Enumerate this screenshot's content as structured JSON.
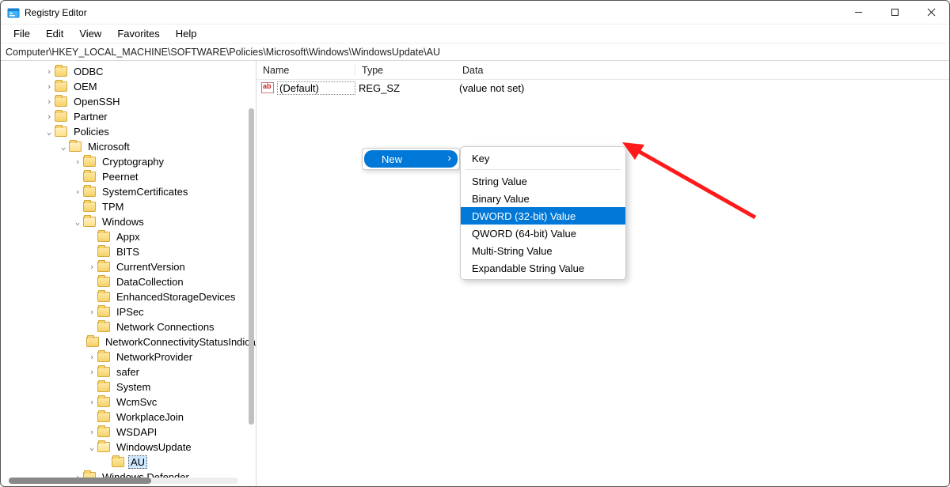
{
  "window": {
    "title": "Registry Editor"
  },
  "menu": {
    "items": [
      "File",
      "Edit",
      "View",
      "Favorites",
      "Help"
    ]
  },
  "address": {
    "path": "Computer\\HKEY_LOCAL_MACHINE\\SOFTWARE\\Policies\\Microsoft\\Windows\\WindowsUpdate\\AU"
  },
  "tree": [
    {
      "indent": 3,
      "expander": ">",
      "label": "ODBC"
    },
    {
      "indent": 3,
      "expander": ">",
      "label": "OEM"
    },
    {
      "indent": 3,
      "expander": ">",
      "label": "OpenSSH"
    },
    {
      "indent": 3,
      "expander": ">",
      "label": "Partner"
    },
    {
      "indent": 3,
      "expander": "v",
      "label": "Policies",
      "open": true
    },
    {
      "indent": 4,
      "expander": "v",
      "label": "Microsoft",
      "open": true
    },
    {
      "indent": 5,
      "expander": ">",
      "label": "Cryptography"
    },
    {
      "indent": 5,
      "expander": "",
      "label": "Peernet"
    },
    {
      "indent": 5,
      "expander": ">",
      "label": "SystemCertificates"
    },
    {
      "indent": 5,
      "expander": "",
      "label": "TPM"
    },
    {
      "indent": 5,
      "expander": "v",
      "label": "Windows",
      "open": true
    },
    {
      "indent": 6,
      "expander": "",
      "label": "Appx"
    },
    {
      "indent": 6,
      "expander": "",
      "label": "BITS"
    },
    {
      "indent": 6,
      "expander": ">",
      "label": "CurrentVersion"
    },
    {
      "indent": 6,
      "expander": "",
      "label": "DataCollection"
    },
    {
      "indent": 6,
      "expander": "",
      "label": "EnhancedStorageDevices"
    },
    {
      "indent": 6,
      "expander": ">",
      "label": "IPSec"
    },
    {
      "indent": 6,
      "expander": "",
      "label": "Network Connections"
    },
    {
      "indent": 6,
      "expander": "",
      "label": "NetworkConnectivityStatusIndicator"
    },
    {
      "indent": 6,
      "expander": ">",
      "label": "NetworkProvider"
    },
    {
      "indent": 6,
      "expander": ">",
      "label": "safer"
    },
    {
      "indent": 6,
      "expander": "",
      "label": "System"
    },
    {
      "indent": 6,
      "expander": ">",
      "label": "WcmSvc"
    },
    {
      "indent": 6,
      "expander": "",
      "label": "WorkplaceJoin"
    },
    {
      "indent": 6,
      "expander": ">",
      "label": "WSDAPI"
    },
    {
      "indent": 6,
      "expander": "v",
      "label": "WindowsUpdate",
      "open": true
    },
    {
      "indent": 7,
      "expander": "",
      "label": "AU",
      "selected": true
    },
    {
      "indent": 5,
      "expander": ">",
      "label": "Windows Defender"
    }
  ],
  "list": {
    "headers": {
      "name": "Name",
      "type": "Type",
      "data": "Data"
    },
    "rows": [
      {
        "name": "(Default)",
        "type": "REG_SZ",
        "data": "(value not set)"
      }
    ]
  },
  "context_menu": {
    "parent_label": "New",
    "sub_items": [
      {
        "label": "Key",
        "sep_after": true
      },
      {
        "label": "String Value"
      },
      {
        "label": "Binary Value"
      },
      {
        "label": "DWORD (32-bit) Value",
        "highlighted": true
      },
      {
        "label": "QWORD (64-bit) Value"
      },
      {
        "label": "Multi-String Value"
      },
      {
        "label": "Expandable String Value"
      }
    ]
  },
  "annotation": {
    "color": "#ff1a1a"
  }
}
